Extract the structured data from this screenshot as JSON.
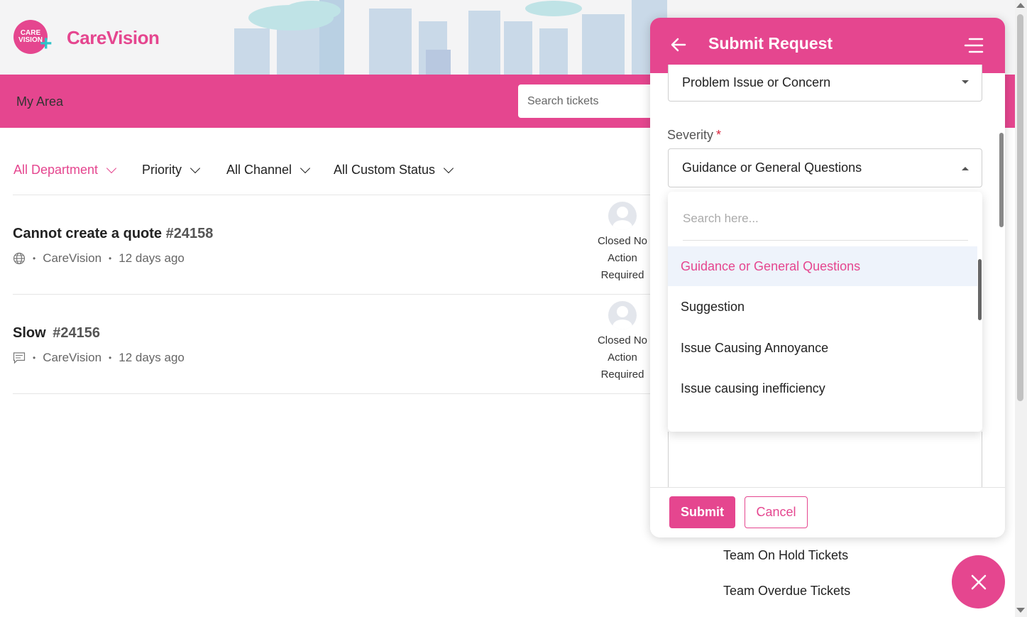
{
  "brand": {
    "logo_text": "CARE VISION",
    "name": "CareVision",
    "accent": "#e5468f"
  },
  "nav": {
    "my_area": "My Area",
    "search_placeholder": "Search tickets"
  },
  "filters": [
    "All Department",
    "Priority",
    "All Channel",
    "All Custom Status"
  ],
  "tickets": [
    {
      "title": "Cannot create a quote",
      "id": "#24158",
      "channel_icon": "globe-icon",
      "source": "CareVision",
      "age": "12 days ago",
      "status_lines": [
        "Closed No",
        "Action",
        "Required"
      ]
    },
    {
      "title": "Slow",
      "id": "#24156",
      "channel_icon": "chat-icon",
      "source": "CareVision",
      "age": "12 days ago",
      "status_lines": [
        "Closed No",
        "Action",
        "Required"
      ]
    }
  ],
  "right_links": [
    "Team On Hold Tickets",
    "Team Overdue Tickets"
  ],
  "panel": {
    "title": "Submit Request",
    "category_value": "Problem Issue or Concern",
    "severity_label": "Severity",
    "required_mark": "*",
    "severity_value": "Guidance or General Questions",
    "dropdown": {
      "search_placeholder": "Search here...",
      "options": [
        "Guidance or General Questions",
        "Suggestion",
        "Issue Causing Annoyance",
        "Issue causing inefficiency"
      ],
      "selected": "Guidance or General Questions"
    },
    "submit_label": "Submit",
    "cancel_label": "Cancel"
  }
}
